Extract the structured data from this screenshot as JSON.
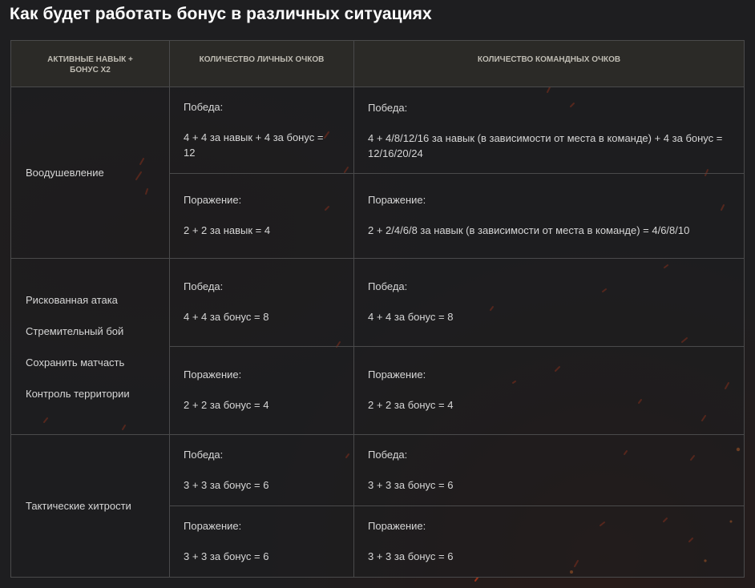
{
  "title": "Как будет работать бонус в различных ситуациях",
  "columns": {
    "skill": "АКТИВНЫЕ НАВЫК + БОНУС Х2",
    "personal": "КОЛИЧЕСТВО ЛИЧНЫХ ОЧКОВ",
    "team": "КОЛИЧЕСТВО КОМАНДНЫХ ОЧКОВ"
  },
  "groups": [
    {
      "skills": [
        "Воодушевление"
      ],
      "win": {
        "label": "Победа:",
        "personal": "4 + 4 за навык + 4 за бонус = 12",
        "team": "4 + 4/8/12/16 за навык (в зависимости от места в команде) + 4 за бонус = 12/16/20/24"
      },
      "loss": {
        "label": "Поражение:",
        "personal": "2 + 2 за навык = 4",
        "team": "2 + 2/4/6/8 за навык (в зависимости от места в команде) = 4/6/8/10"
      }
    },
    {
      "skills": [
        "Рискованная атака",
        "Стремительный бой",
        "Сохранить матчасть",
        "Контроль территории"
      ],
      "win": {
        "label": "Победа:",
        "personal": "4 + 4 за бонус = 8",
        "team": "4 + 4 за бонус = 8"
      },
      "loss": {
        "label": "Поражение:",
        "personal": "2 + 2 за бонус = 4",
        "team": "2 + 2 за бонус = 4"
      }
    },
    {
      "skills": [
        "Тактические хитрости"
      ],
      "win": {
        "label": "Победа:",
        "personal": "3 + 3 за бонус = 6",
        "team": "3 + 3 за бонус = 6"
      },
      "loss": {
        "label": "Поражение:",
        "personal": "3 + 3 за бонус = 6",
        "team": "3 + 3 за бонус = 6"
      }
    }
  ],
  "colors": {
    "background": "#1e1e20",
    "header_background": "#2b2a27",
    "border": "#4a4a4b",
    "text": "#d6d6d6",
    "title": "#ffffff",
    "spark": "#d2401c"
  }
}
